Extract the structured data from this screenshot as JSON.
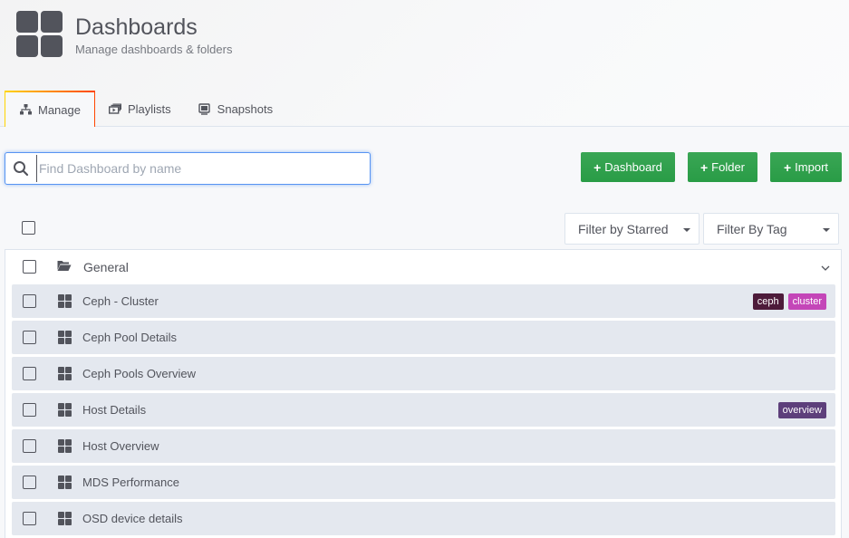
{
  "header": {
    "title": "Dashboards",
    "subtitle": "Manage dashboards & folders"
  },
  "tabs": [
    {
      "label": "Manage",
      "icon": "sitemap-icon",
      "active": true
    },
    {
      "label": "Playlists",
      "icon": "playlist-icon",
      "active": false
    },
    {
      "label": "Snapshots",
      "icon": "snapshot-icon",
      "active": false
    }
  ],
  "search": {
    "placeholder": "Find Dashboard by name",
    "value": ""
  },
  "actions": {
    "dashboard_label": "Dashboard",
    "folder_label": "Folder",
    "import_label": "Import",
    "plus": "+"
  },
  "filters": {
    "starred_label": "Filter by Starred",
    "tag_label": "Filter By Tag"
  },
  "folder": {
    "label": "General",
    "expanded": true
  },
  "dashboards": [
    {
      "label": "Ceph - Cluster",
      "tags": [
        {
          "text": "ceph",
          "color": "#4d1b3a"
        },
        {
          "text": "cluster",
          "color": "#c446b8"
        }
      ]
    },
    {
      "label": "Ceph Pool Details",
      "tags": []
    },
    {
      "label": "Ceph Pools Overview",
      "tags": []
    },
    {
      "label": "Host Details",
      "tags": [
        {
          "text": "overview",
          "color": "#5d3f7b"
        }
      ]
    },
    {
      "label": "Host Overview",
      "tags": []
    },
    {
      "label": "MDS Performance",
      "tags": []
    },
    {
      "label": "OSD device details",
      "tags": []
    }
  ],
  "colors": {
    "accent_green": "#299c46",
    "focus_blue": "#5794f2",
    "row_bg": "#e4e8ef",
    "text": "#52545c"
  }
}
